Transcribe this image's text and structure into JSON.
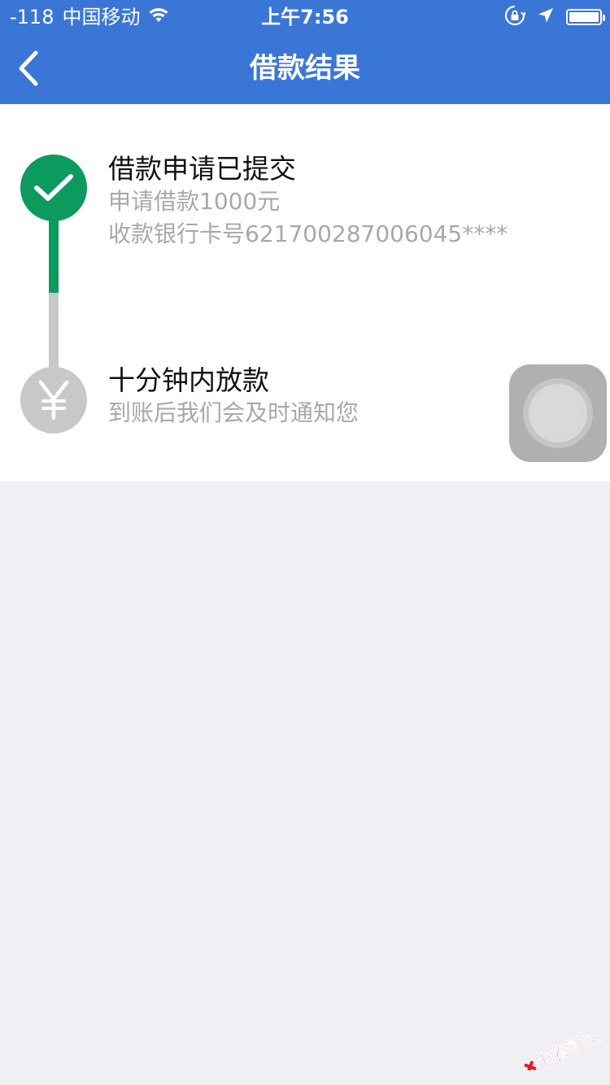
{
  "status_bar": {
    "signal": "-118",
    "carrier": "中国移动",
    "time": "上午7:56",
    "icons": [
      "wifi-icon",
      "orientation-lock-icon",
      "location-icon",
      "battery-icon"
    ]
  },
  "nav": {
    "title": "借款结果",
    "back_icon": "chevron-left-icon"
  },
  "steps": [
    {
      "icon": "checkmark-icon",
      "status": "done",
      "color": "#0d9a5f",
      "title": "借款申请已提交",
      "lines": [
        "申请借款1000元",
        "收款银行卡号621700287006045****"
      ]
    },
    {
      "icon": "yuan-icon",
      "status": "pending",
      "color": "#c8c8c8",
      "title": "十分钟内放款",
      "lines": [
        "到账后我们会及时通知您"
      ]
    }
  ],
  "colors": {
    "header_bg": "#3a76d6",
    "page_bg": "#efeff4",
    "done": "#0d9a5f",
    "pending": "#c8c8c8",
    "subtext": "#a8a8a8"
  },
  "watermark": {
    "text": "卡农社区",
    "icon": "logo-mark-icon"
  }
}
